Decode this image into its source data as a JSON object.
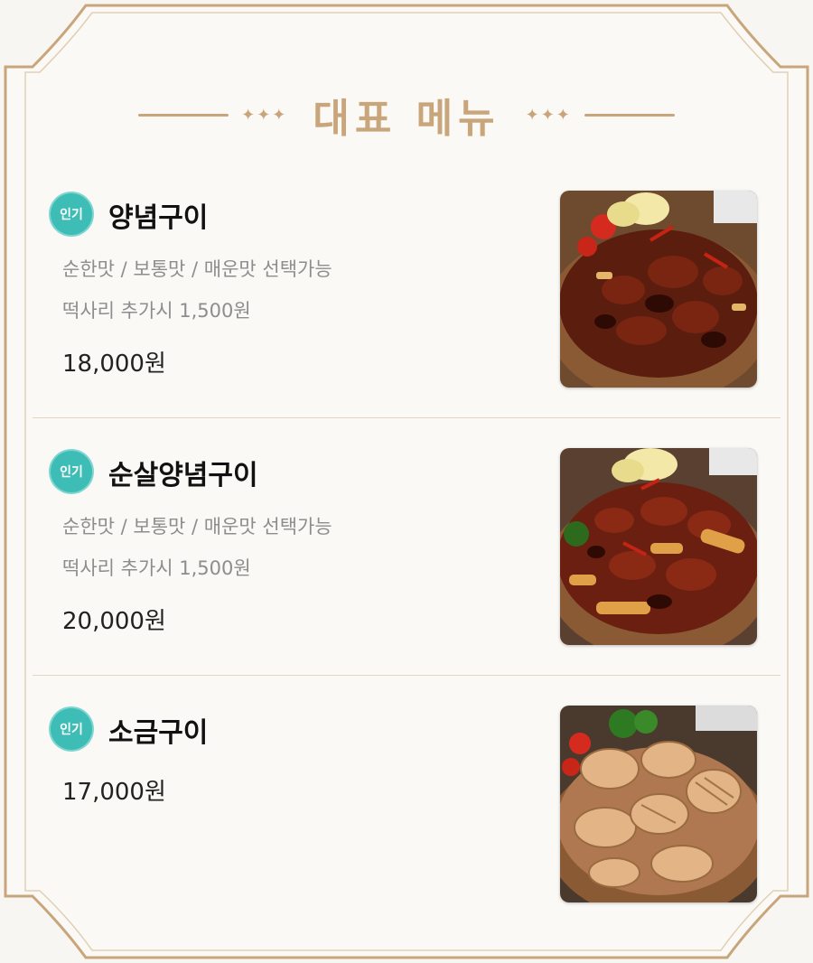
{
  "page_title": "대표 메뉴",
  "heading_ornament": "✦✦✦",
  "colors": {
    "accent": "#c9a57b",
    "badge": "#3dbdb5",
    "price": "#222222",
    "desc": "#8d8d8d"
  },
  "menu": [
    {
      "badge": "인기",
      "name": "양념구이",
      "desc1": "순한맛 / 보통맛 / 매운맛 선택가능",
      "desc2": "떡사리 추가시 1,500원",
      "price": "18,000원",
      "photo_icon": "spicy-chicken-dish-photo"
    },
    {
      "badge": "인기",
      "name": "순살양념구이",
      "desc1": "순한맛 / 보통맛 / 매운맛 선택가능",
      "desc2": "떡사리 추가시 1,500원",
      "price": "20,000원",
      "photo_icon": "boneless-spicy-chicken-photo"
    },
    {
      "badge": "인기",
      "name": "소금구이",
      "price": "17,000원",
      "photo_icon": "salt-grilled-chicken-photo"
    }
  ]
}
